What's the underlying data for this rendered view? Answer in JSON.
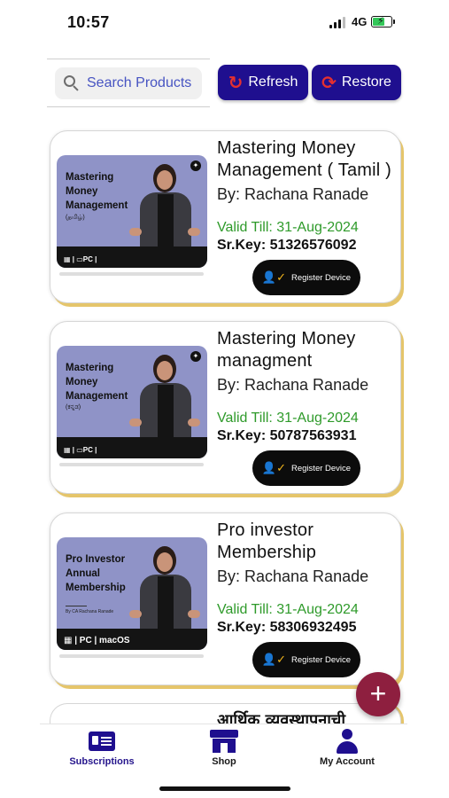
{
  "status_bar": {
    "time": "10:57",
    "network": "4G",
    "battery_level": 0.7
  },
  "toolbar": {
    "search_placeholder": "Search Products",
    "refresh_label": "Refresh",
    "restore_label": "Restore"
  },
  "subscriptions": [
    {
      "title": "Mastering Money Management ( Tamil )",
      "author": "By: Rachana Ranade",
      "valid_till": "Valid Till: 31-Aug-2024",
      "serial_key": "Sr.Key: 51326576092",
      "register_label": "Register Device",
      "thumb_title_lines": [
        "Mastering",
        "Money",
        "Management"
      ],
      "thumb_lang": "(தமிழ்)",
      "thumb_platforms": "▦ | ▭PC | ",
      "progress": 0
    },
    {
      "title": "Mastering Money managment",
      "author": "By: Rachana Ranade",
      "valid_till": "Valid Till: 31-Aug-2024",
      "serial_key": "Sr.Key: 50787563931",
      "register_label": "Register Device",
      "thumb_title_lines": [
        "Mastering",
        "Money",
        "Management"
      ],
      "thumb_lang": "(ಕನ್ನಡ)",
      "thumb_platforms": "▦ | ▭PC | ",
      "progress": 0
    },
    {
      "title": "Pro investor Membership",
      "author": "By: Rachana Ranade",
      "valid_till": "Valid Till: 31-Aug-2024",
      "serial_key": "Sr.Key: 58306932495",
      "register_label": "Register Device",
      "thumb_title_lines": [
        "Pro Investor",
        "Annual",
        "Membership"
      ],
      "thumb_sub": "By CA Rachana Ranade",
      "thumb_platforms": "▦ | PC | macOS",
      "progress": 0
    }
  ],
  "partial_card": {
    "title": "आर्थिक व्यवस्थापनाची"
  },
  "fab_label": "+",
  "tabs": [
    {
      "label": "Subscriptions",
      "icon": "id-card-icon",
      "active": true
    },
    {
      "label": "Shop",
      "icon": "shop-icon",
      "active": false
    },
    {
      "label": "My Account",
      "icon": "user-icon",
      "active": false
    }
  ],
  "colors": {
    "primary": "#1f0f8f",
    "valid_green": "#2e9a2a",
    "fab": "#8e1f3f",
    "card_shadow": "#e5c56b"
  }
}
